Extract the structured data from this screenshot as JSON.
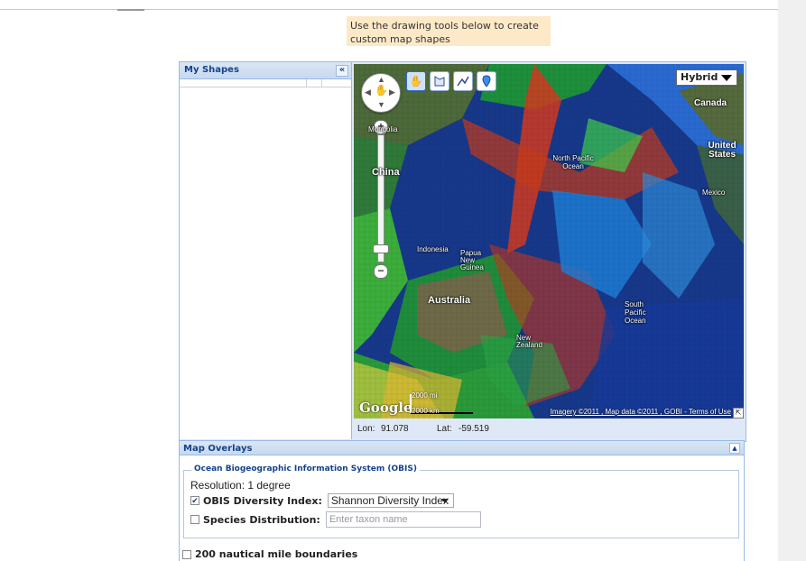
{
  "instruction_tip": "Use the drawing tools below to create custom map shapes",
  "shapes_panel": {
    "title": "My Shapes",
    "collapse_icon": "«"
  },
  "map": {
    "type_control": "Hybrid",
    "tools": [
      "hand-icon",
      "polygon-icon",
      "polyline-icon",
      "marker-icon"
    ],
    "labels": {
      "canada": "Canada",
      "united_states": "United States",
      "china": "China",
      "australia": "Australia",
      "north_pacific_ocean": "North Pacific Ocean",
      "south_pacific_ocean": "South Pacific Ocean",
      "indonesia": "Indonesia",
      "papua_new_guinea": "Papua New Guinea",
      "mexico": "Mexico",
      "mongolia": "Mongolia",
      "new_zealand": "New Zealand"
    },
    "logo": "Google",
    "scale_miles": "2000 mi",
    "scale_km": "2000 km",
    "attribution": "Imagery ©2011 , Map data ©2011 , GOBI - Terms of Use",
    "coords": {
      "lon_label": "Lon:",
      "lon_value": "91.078",
      "lat_label": "Lat:",
      "lat_value": "-59.519"
    }
  },
  "overlays": {
    "title": "Map Overlays",
    "obis": {
      "legend": "Ocean Biogeographic Information System (OBIS)",
      "resolution": "Resolution: 1 degree",
      "diversity_label": "OBIS Diversity Index:",
      "diversity_checked": true,
      "diversity_selected": "Shannon Diversity Index",
      "species_label": "Species Distribution:",
      "species_checked": false,
      "species_placeholder": "Enter taxon name"
    },
    "boundaries_label": "200 nautical mile boundaries",
    "boundaries_checked": false
  }
}
